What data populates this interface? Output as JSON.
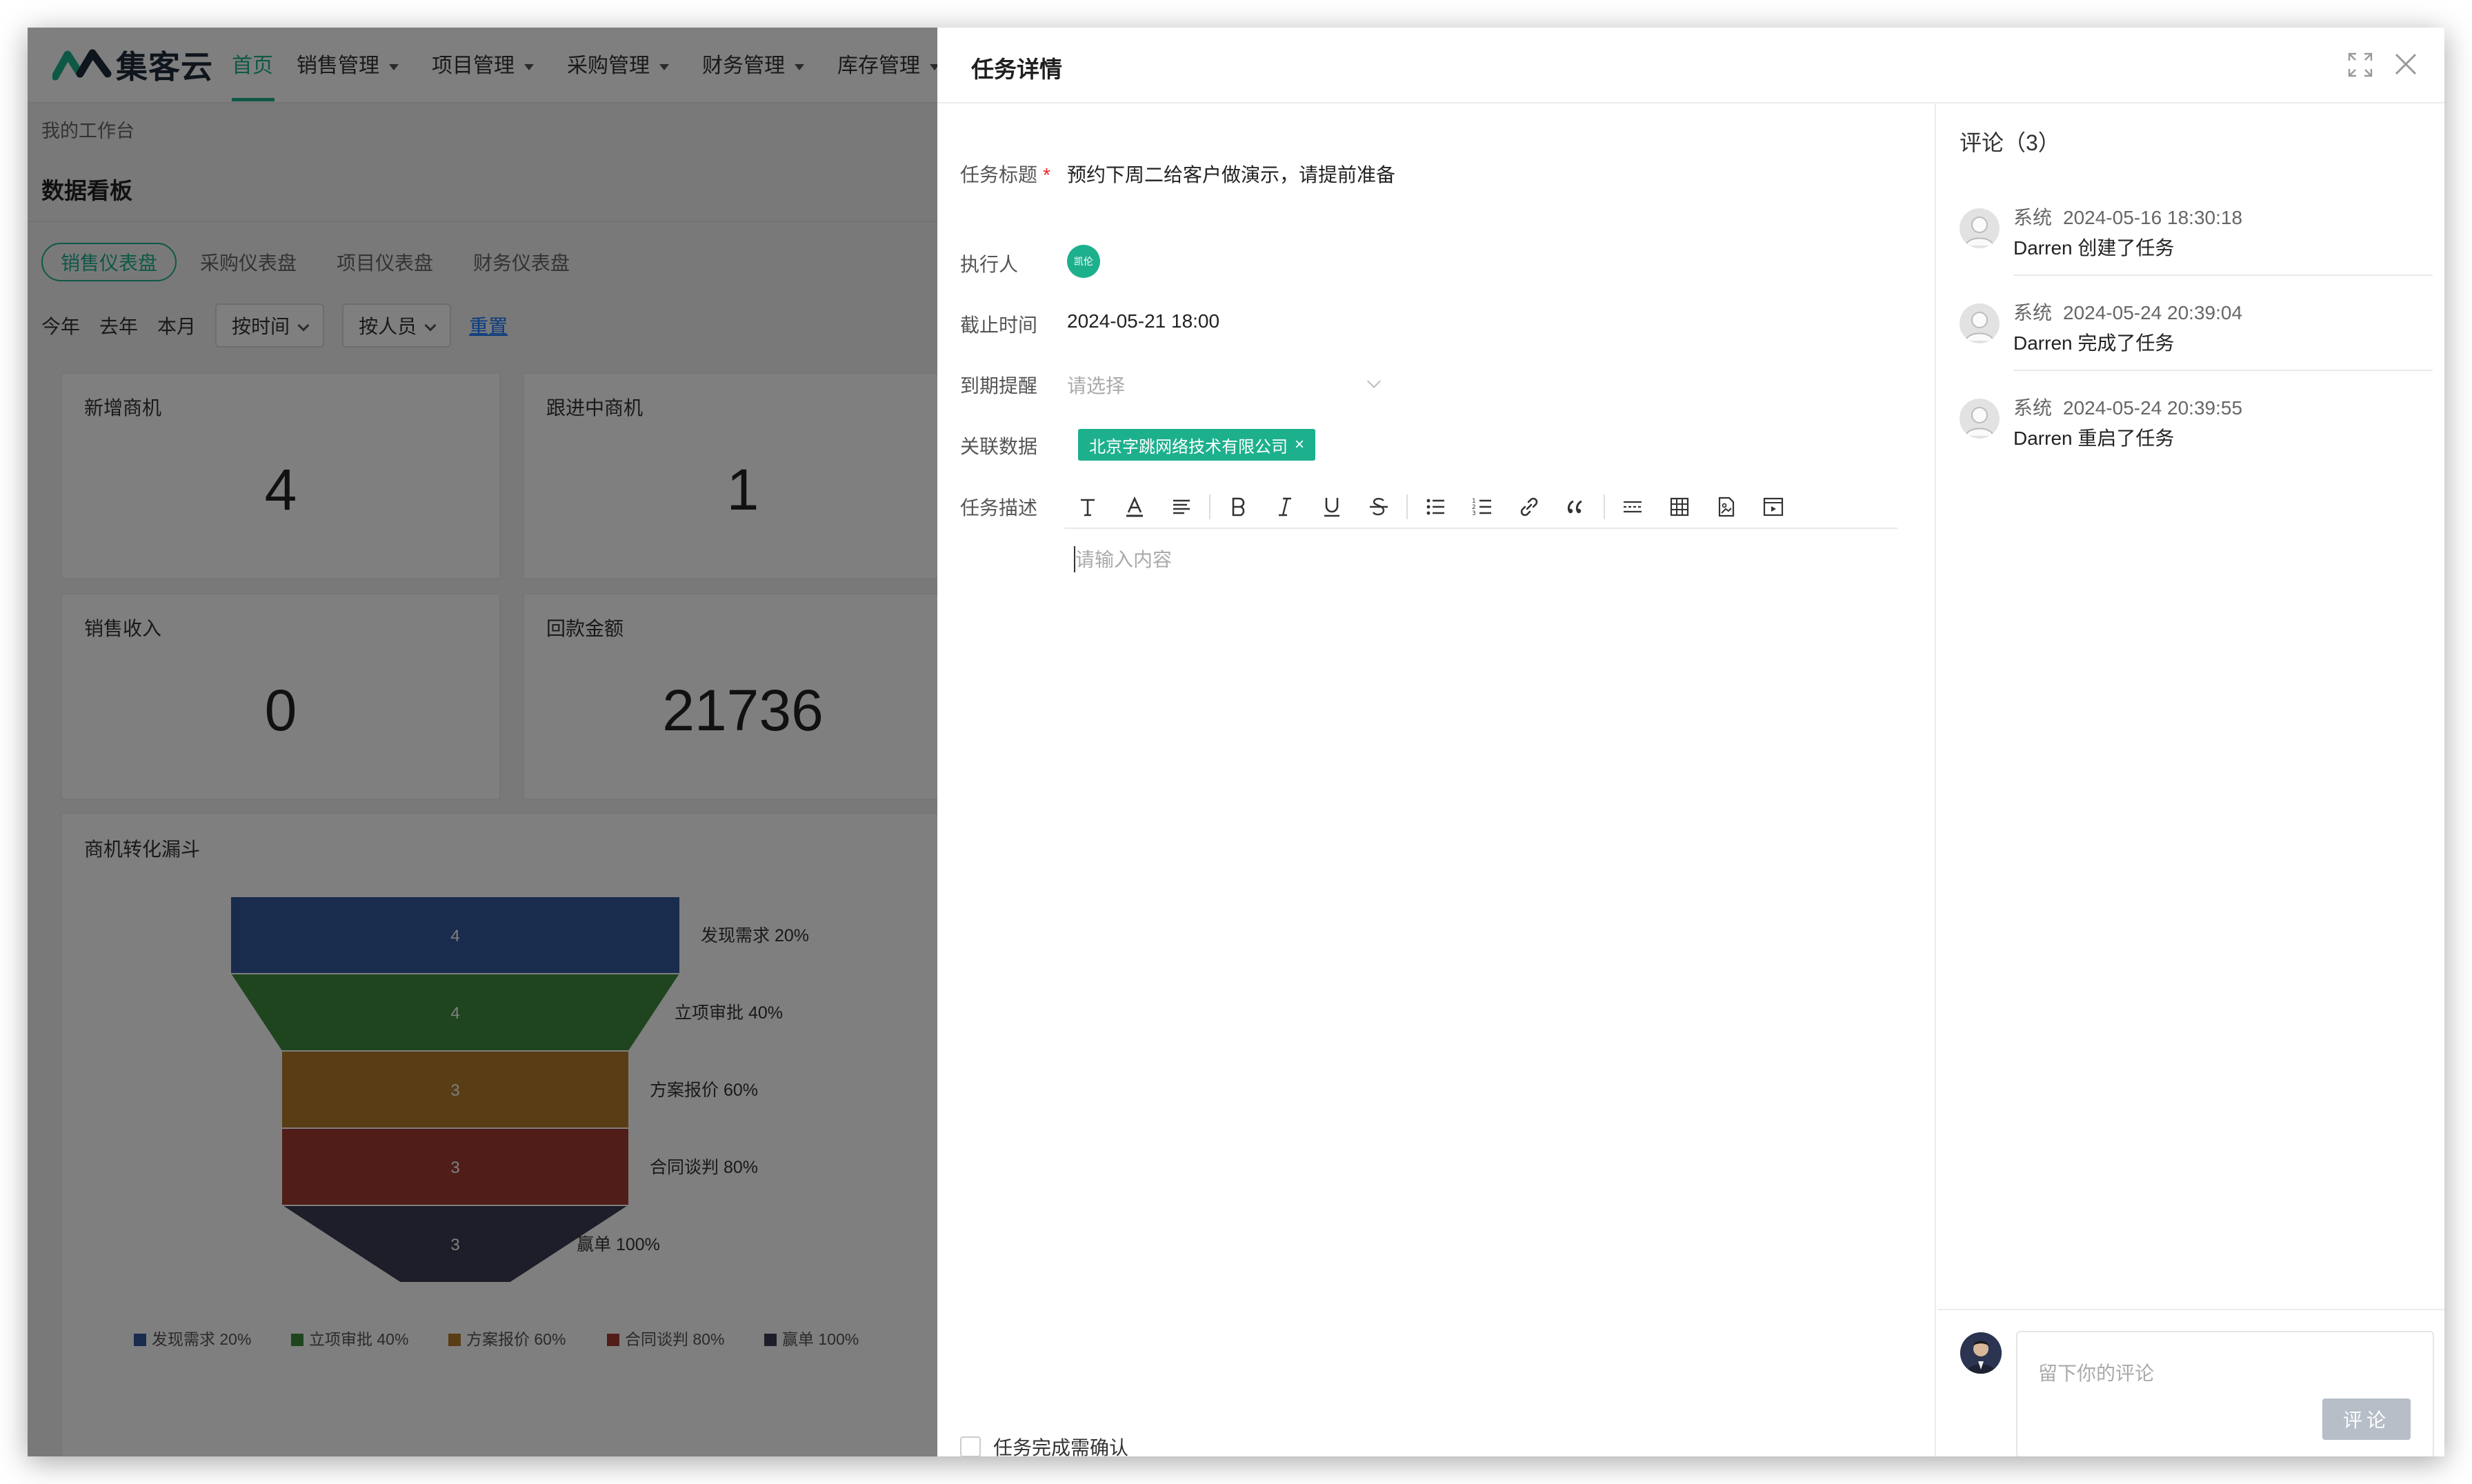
{
  "app": {
    "brand": "集客云",
    "nav": [
      "首页",
      "销售管理",
      "项目管理",
      "采购管理",
      "财务管理",
      "库存管理"
    ],
    "breadcrumb": "我的工作台",
    "board_title": "数据看板",
    "dashboard_tabs": [
      "销售仪表盘",
      "采购仪表盘",
      "项目仪表盘",
      "财务仪表盘"
    ],
    "filters": {
      "this_year": "今年",
      "last_year": "去年",
      "this_month": "本月",
      "by_time": "按时间",
      "by_person": "按人员",
      "reset": "重置"
    },
    "cards": [
      {
        "title": "新增商机",
        "value": "4"
      },
      {
        "title": "跟进中商机",
        "value": "1"
      },
      {
        "title": "销售收入",
        "value": "0"
      },
      {
        "title": "回款金额",
        "value": "21736"
      }
    ],
    "funnel_title": "商机转化漏斗"
  },
  "chart_data": {
    "type": "funnel",
    "title": "商机转化漏斗",
    "categories": [
      "发现需求",
      "立项审批",
      "方案报价",
      "合同谈判",
      "赢单"
    ],
    "values": [
      4,
      4,
      3,
      3,
      3
    ],
    "labels": [
      "发现需求 20%",
      "立项审批 40%",
      "方案报价 60%",
      "合同谈判 80%",
      "赢单 100%"
    ],
    "colors": [
      "#34589a",
      "#3f8a3f",
      "#b07a2a",
      "#a13a32",
      "#3a3d52"
    ],
    "legend": [
      "发现需求 20%",
      "立项审批 40%",
      "方案报价 60%",
      "合同谈判 80%",
      "赢单 100%"
    ],
    "legend_position": "bottom"
  },
  "drawer": {
    "title": "任务详情",
    "fields": {
      "title_label": "任务标题",
      "title_value": "预约下周二给客户做演示，请提前准备",
      "assignee_label": "执行人",
      "assignee_avatar": "凯伦",
      "deadline_label": "截止时间",
      "deadline_value": "2024-05-21 18:00",
      "remind_label": "到期提醒",
      "remind_placeholder": "请选择",
      "related_label": "关联数据",
      "related_tag": "北京字跳网络技术有限公司",
      "desc_label": "任务描述",
      "desc_placeholder": "请输入内容"
    },
    "confirm_label": "任务完成需确认",
    "comments": {
      "title": "评论（3）",
      "items": [
        {
          "author": "系统",
          "time": "2024-05-16 18:30:18",
          "text": "Darren 创建了任务"
        },
        {
          "author": "系统",
          "time": "2024-05-24 20:39:04",
          "text": "Darren 完成了任务"
        },
        {
          "author": "系统",
          "time": "2024-05-24 20:39:55",
          "text": "Darren 重启了任务"
        }
      ],
      "input_placeholder": "留下你的评论",
      "submit_label": "评论"
    },
    "toolbar_icons": [
      "text-style-icon",
      "font-color-icon",
      "align-icon",
      "bold-icon",
      "italic-icon",
      "underline-icon",
      "strikethrough-icon",
      "bullet-list-icon",
      "ordered-list-icon",
      "link-icon",
      "quote-icon",
      "divider-icon",
      "table-icon",
      "image-icon",
      "video-icon"
    ]
  },
  "colors": {
    "accent": "#1db08d",
    "link": "#1677ff",
    "required": "#f5222d"
  }
}
